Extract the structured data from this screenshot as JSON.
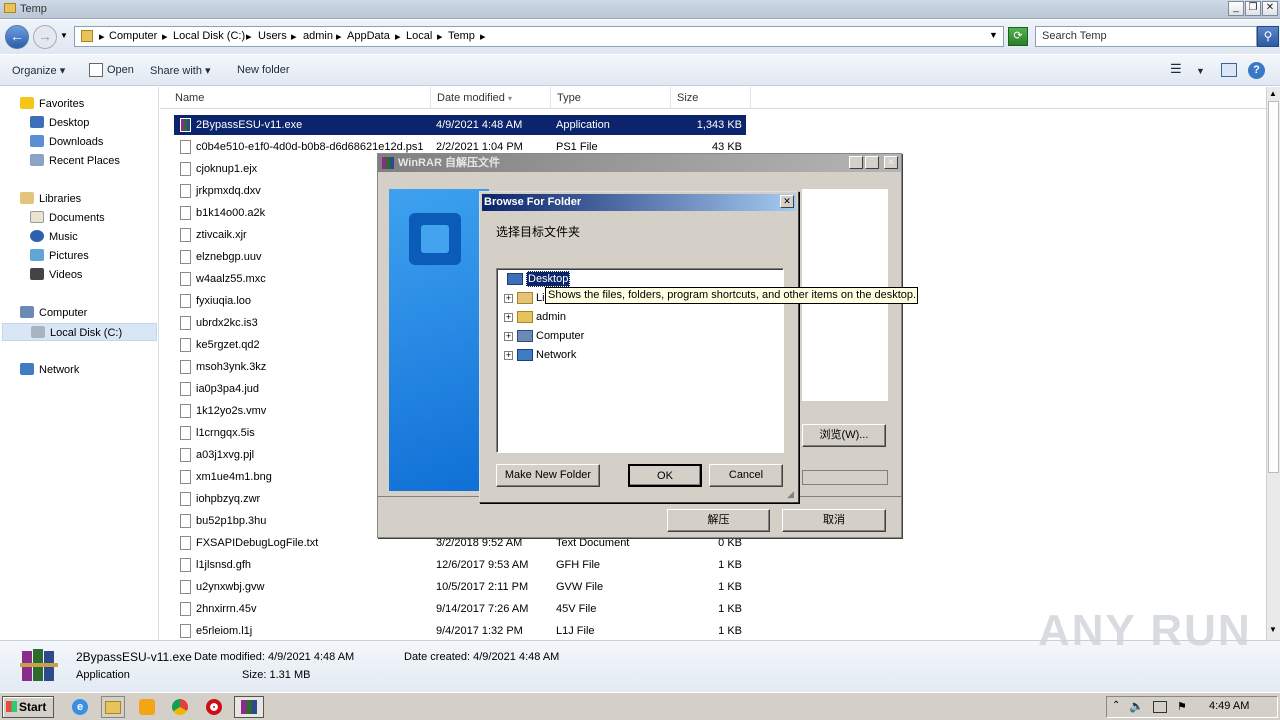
{
  "window": {
    "title": "Temp"
  },
  "address": {
    "crumbs": [
      "Computer",
      "Local Disk (C:)",
      "Users",
      "admin",
      "AppData",
      "Local",
      "Temp"
    ],
    "search_placeholder": "Search Temp"
  },
  "toolbar": {
    "organize": "Organize",
    "open": "Open",
    "share": "Share with",
    "new_folder": "New folder"
  },
  "nav": {
    "favorites": "Favorites",
    "desktop": "Desktop",
    "downloads": "Downloads",
    "recent": "Recent Places",
    "libraries": "Libraries",
    "documents": "Documents",
    "music": "Music",
    "pictures": "Pictures",
    "videos": "Videos",
    "computer": "Computer",
    "localdisk": "Local Disk (C:)",
    "network": "Network"
  },
  "columns": {
    "name": "Name",
    "date": "Date modified",
    "type": "Type",
    "size": "Size"
  },
  "files": [
    {
      "name": "2BypassESU-v11.exe",
      "date": "4/9/2021 4:48 AM",
      "type": "Application",
      "size": "1,343 KB"
    },
    {
      "name": "c0b4e510-e1f0-4d0d-b0b8-d6d68621e12d.ps1",
      "date": "2/2/2021 1:04 PM",
      "type": "PS1 File",
      "size": "43 KB"
    },
    {
      "name": "cjoknup1.ejx",
      "date": "",
      "type": "",
      "size": ""
    },
    {
      "name": "jrkpmxdq.dxv",
      "date": "",
      "type": "",
      "size": ""
    },
    {
      "name": "b1k14o00.a2k",
      "date": "",
      "type": "",
      "size": ""
    },
    {
      "name": "ztivcaik.xjr",
      "date": "",
      "type": "",
      "size": ""
    },
    {
      "name": "elznebgp.uuv",
      "date": "",
      "type": "",
      "size": ""
    },
    {
      "name": "w4aalz55.mxc",
      "date": "",
      "type": "",
      "size": ""
    },
    {
      "name": "fyxiuqia.loo",
      "date": "",
      "type": "",
      "size": ""
    },
    {
      "name": "ubrdx2kc.is3",
      "date": "",
      "type": "",
      "size": ""
    },
    {
      "name": "ke5rgzet.qd2",
      "date": "",
      "type": "",
      "size": ""
    },
    {
      "name": "msoh3ynk.3kz",
      "date": "",
      "type": "",
      "size": ""
    },
    {
      "name": "ia0p3pa4.jud",
      "date": "",
      "type": "",
      "size": ""
    },
    {
      "name": "1k12yo2s.vmv",
      "date": "",
      "type": "",
      "size": ""
    },
    {
      "name": "l1crngqx.5is",
      "date": "",
      "type": "",
      "size": ""
    },
    {
      "name": "a03j1xvg.pjl",
      "date": "",
      "type": "",
      "size": ""
    },
    {
      "name": "xm1ue4m1.bng",
      "date": "",
      "type": "",
      "size": ""
    },
    {
      "name": "iohpbzyq.zwr",
      "date": "",
      "type": "",
      "size": ""
    },
    {
      "name": "bu52p1bp.3hu",
      "date": "",
      "type": "",
      "size": ""
    },
    {
      "name": "FXSAPIDebugLogFile.txt",
      "date": "3/2/2018 9:52 AM",
      "type": "Text Document",
      "size": "0 KB"
    },
    {
      "name": "l1jlsnsd.gfh",
      "date": "12/6/2017 9:53 AM",
      "type": "GFH File",
      "size": "1 KB"
    },
    {
      "name": "u2ynxwbj.gvw",
      "date": "10/5/2017 2:11 PM",
      "type": "GVW File",
      "size": "1 KB"
    },
    {
      "name": "2hnxirrn.45v",
      "date": "9/14/2017 7:26 AM",
      "type": "45V File",
      "size": "1 KB"
    },
    {
      "name": "e5rleiom.l1j",
      "date": "9/4/2017 1:32 PM",
      "type": "L1J File",
      "size": "1 KB"
    }
  ],
  "details": {
    "filename": "2BypassESU-v11.exe",
    "type": "Application",
    "modified": "Date modified: 4/9/2021 4:48 AM",
    "created": "Date created: 4/9/2021 4:48 AM",
    "size": "Size: 1.31 MB"
  },
  "winrar": {
    "title": "WinRAR 自解压文件",
    "browse_btn": "浏览(W)...",
    "extract_btn": "解压",
    "cancel_btn": "取消"
  },
  "browse": {
    "title": "Browse For Folder",
    "prompt": "选择目标文件夹",
    "items": [
      "Desktop",
      "Libraries",
      "admin",
      "Computer",
      "Network"
    ],
    "tooltip": "Shows the files, folders, program shortcuts, and other items on the desktop.",
    "new_folder": "Make New Folder",
    "ok": "OK",
    "cancel": "Cancel"
  },
  "taskbar": {
    "start": "Start",
    "clock": "4:49 AM"
  },
  "watermark": "ANY RUN"
}
